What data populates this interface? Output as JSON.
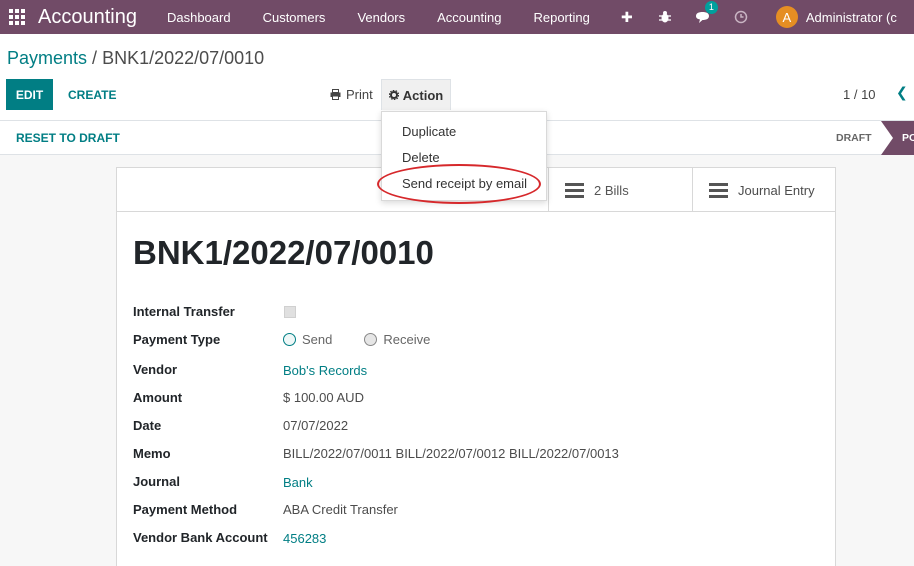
{
  "navbar": {
    "brand": "Accounting",
    "menu": [
      "Dashboard",
      "Customers",
      "Vendors",
      "Accounting",
      "Reporting"
    ],
    "plus_glyph": "✚",
    "bug_glyph": "🐞",
    "chat_glyph": "💬",
    "chat_count": "1",
    "clock_glyph": "◷",
    "user_initial": "A",
    "user_name": "Administrator (c"
  },
  "breadcrumb": {
    "parent": "Payments",
    "separator": " / ",
    "current": "BNK1/2022/07/0010"
  },
  "toolbar": {
    "edit_label": "EDIT",
    "create_label": "CREATE",
    "print_label": "Print",
    "print_glyph": "⎙",
    "action_label": "Action",
    "action_glyph": "✱"
  },
  "pager": {
    "value": "1 / 10",
    "prev_glyph": "❮"
  },
  "action_menu": {
    "items": [
      "Duplicate",
      "Delete",
      "Send receipt by email"
    ]
  },
  "statusbar": {
    "reset_label": "RESET TO DRAFT",
    "stages": [
      "DRAFT",
      "PO"
    ]
  },
  "smart_buttons": {
    "bills_count": "2",
    "bills_label": "Bills",
    "journal_label": "Journal Entry"
  },
  "record": {
    "title": "BNK1/2022/07/0010",
    "fields": {
      "internal_transfer_label": "Internal Transfer",
      "payment_type_label": "Payment Type",
      "payment_type_send": "Send",
      "payment_type_receive": "Receive",
      "vendor_label": "Vendor",
      "vendor_value": "Bob's Records",
      "amount_label": "Amount",
      "amount_value": "$ 100.00",
      "amount_currency": "AUD",
      "date_label": "Date",
      "date_value": "07/07/2022",
      "memo_label": "Memo",
      "memo_value": "BILL/2022/07/0011 BILL/2022/07/0012 BILL/2022/07/0013",
      "journal_label": "Journal",
      "journal_value": "Bank",
      "payment_method_label": "Payment Method",
      "payment_method_value": "ABA Credit Transfer",
      "vendor_bank_label": "Vendor Bank Account",
      "vendor_bank_value": "456283"
    }
  },
  "colors": {
    "navbar": "#714b67",
    "primary": "#017e84",
    "highlight": "#d6282b"
  }
}
